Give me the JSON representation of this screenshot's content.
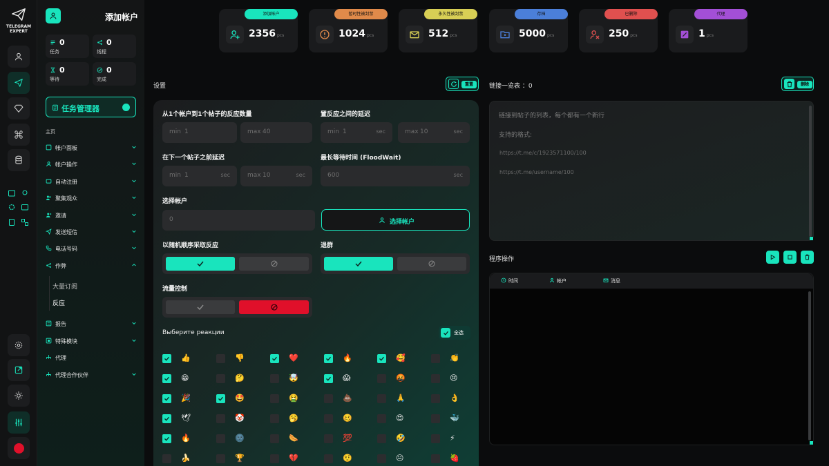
{
  "brand": {
    "line1": "TELEGRAM",
    "line2": "EXPERT"
  },
  "sidebar": {
    "title": "添加帐户",
    "stats": [
      {
        "value": "0",
        "label": "任务"
      },
      {
        "value": "0",
        "label": "线程"
      },
      {
        "value": "0",
        "label": "等待"
      },
      {
        "value": "0",
        "label": "完成"
      }
    ],
    "task_manager": "任务管理器",
    "section": "主页",
    "menu": [
      {
        "label": "帐户面板"
      },
      {
        "label": "帐户操作"
      },
      {
        "label": "自动注册"
      },
      {
        "label": "聚集观众"
      },
      {
        "label": "邀请"
      },
      {
        "label": "发送短信"
      },
      {
        "label": "电话号码"
      },
      {
        "label": "作弊"
      }
    ],
    "submenu": [
      "大量订阅",
      "反应"
    ],
    "menu2": [
      {
        "label": "报告"
      },
      {
        "label": "特殊模块"
      },
      {
        "label": "代理"
      },
      {
        "label": "代理合作伙伴"
      }
    ]
  },
  "top_stats": [
    {
      "label": "添加帐户",
      "value": "2356",
      "unit": "pcs",
      "color": "#19e4bd"
    },
    {
      "label": "暂时性被封禁",
      "value": "1024",
      "unit": "pcs",
      "color": "#e08a4a"
    },
    {
      "label": "永久性被封禁",
      "value": "512",
      "unit": "pcs",
      "color": "#d8cf55"
    },
    {
      "label": "存档",
      "value": "5000",
      "unit": "pcs",
      "color": "#4b7fd9"
    },
    {
      "label": "已删除",
      "value": "250",
      "unit": "pcs",
      "color": "#e0504f"
    },
    {
      "label": "代理",
      "value": "1",
      "unit": "pcs",
      "color": "#a34fd6"
    }
  ],
  "settings": {
    "title": "设置",
    "reset": "重置",
    "f1_label": "从1个帐户到1个帖子的反应数量",
    "f1_min": "1",
    "f1_max": "40",
    "f2_label": "置反应之间的延迟",
    "f2_min": "1",
    "f2_max": "10",
    "f3_label": "在下一个帖子之前延迟",
    "f3_min": "1",
    "f3_max": "10",
    "f4_label": "最长等待时间 (FloodWait)",
    "f4_value": "600",
    "min_k": "min",
    "max_k": "max",
    "sec_u": "sec",
    "acc_label": "选择帐户",
    "acc_value": "0",
    "acc_btn": "选择帐户",
    "random_label": "以随机顺序采取反应",
    "leave_label": "退群",
    "flow_label": "流量控制",
    "reactions_label": "Выберите реакции",
    "select_all": "全选"
  },
  "reactions": [
    [
      "👍",
      true
    ],
    [
      "👎",
      false
    ],
    [
      "❤️",
      true
    ],
    [
      "🔥",
      true
    ],
    [
      "🥰",
      true
    ],
    [
      "👏",
      false
    ],
    [
      "😁",
      true
    ],
    [
      "🤔",
      false
    ],
    [
      "🤯",
      false
    ],
    [
      "😱",
      true
    ],
    [
      "🤬",
      false
    ],
    [
      "😢",
      false
    ],
    [
      "🎉",
      true
    ],
    [
      "🤩",
      true
    ],
    [
      "🤮",
      false
    ],
    [
      "💩",
      false
    ],
    [
      "🙏",
      false
    ],
    [
      "👌",
      false
    ],
    [
      "🕊",
      true
    ],
    [
      "🤡",
      false
    ],
    [
      "🥱",
      false
    ],
    [
      "🥴",
      false
    ],
    [
      "😍",
      false
    ],
    [
      "🐳",
      false
    ],
    [
      "🔥",
      true
    ],
    [
      "🌚",
      false
    ],
    [
      "🌭",
      false
    ],
    [
      "💯",
      false
    ],
    [
      "🤣",
      false
    ],
    [
      "⚡",
      false
    ],
    [
      "🍌",
      false
    ],
    [
      "🏆",
      false
    ],
    [
      "💔",
      false
    ],
    [
      "🤨",
      false
    ],
    [
      "😐",
      false
    ],
    [
      "🍓",
      false
    ]
  ],
  "links": {
    "title": "链接一览表 ：0",
    "delete": "删除",
    "placeholder1": "链接到帖子的列表，每个都有一个新行",
    "placeholder2": "支持的格式:",
    "example1": "https://t.me/c/1923571100/100",
    "example2": "https://t.me/username/100"
  },
  "program": {
    "title": "程序操作",
    "col_time": "时间",
    "col_account": "帐户",
    "col_message": "消息"
  },
  "colors": {
    "accent": "#19e4bd",
    "danger": "#e0102a"
  }
}
